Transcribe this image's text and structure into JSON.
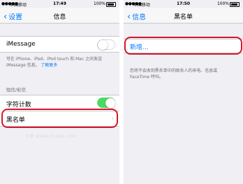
{
  "left": {
    "status": {
      "signal": "●●●●●",
      "carrier": "中国移动",
      "time": "17:49",
      "battery": "100%"
    },
    "nav": {
      "back": "设置",
      "title": "信息"
    },
    "imessage": {
      "label": "iMessage",
      "enabled": false
    },
    "imessage_note": {
      "text": "可在 iPhone、iPad、iPod touch 和 Mac 之间发送 iMessage 信息。",
      "link": "了解更多"
    },
    "section": "短信/彩信",
    "char_count": {
      "label": "字符计数",
      "enabled": true
    },
    "blocked": {
      "label": "黑名单"
    },
    "watermark": "三联 WWW.3LIAN.COM"
  },
  "right": {
    "status": {
      "signal": "●●●●●",
      "carrier": "中国移动",
      "time": "17:50",
      "battery": "100%"
    },
    "nav": {
      "back": "信息",
      "title": "黑名单"
    },
    "add_new": "新增...",
    "note": "您将不会收到黑名单中的联系人的来电、信息或 FaceTime 呼叫。"
  },
  "colors": {
    "accent": "#007aff",
    "highlight": "#d6142a",
    "toggle_on": "#4cd964",
    "background": "#efeff4"
  }
}
